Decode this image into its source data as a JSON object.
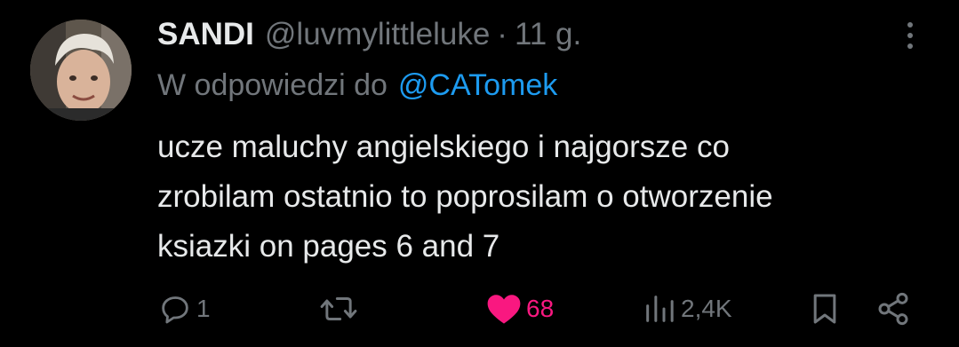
{
  "tweet": {
    "author": {
      "name": "SANDI",
      "handle": "@luvmylittleluke",
      "separator": "·",
      "time": "11 g."
    },
    "reply": {
      "prefix": "W odpowiedzi do",
      "mention": "@CATomek"
    },
    "text_lines": [
      "ucze maluchy angielskiego i najgorsze co",
      "zrobilam ostatnio to poprosilam o otworzenie",
      "ksiazki on pages 6 and 7"
    ],
    "stats": {
      "replies": "1",
      "reposts": "",
      "likes": "68",
      "views": "2,4K"
    }
  },
  "icons": {
    "more": "more-vertical-icon",
    "reply": "reply-bubble-icon",
    "repost": "repost-icon",
    "like": "heart-filled-icon",
    "views": "views-chart-icon",
    "bookmark": "bookmark-icon",
    "share": "share-icon"
  },
  "colors": {
    "background": "#000000",
    "primary_text": "#e7e9ea",
    "secondary_text": "#71767b",
    "link": "#1d9bf0",
    "like": "#f91880"
  }
}
